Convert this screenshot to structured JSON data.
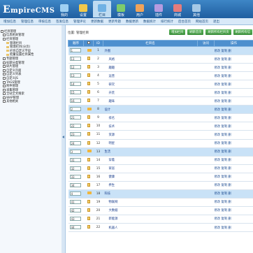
{
  "app": {
    "logo_big": "E",
    "logo_rest": "mpireCMS",
    "logo_dot": "."
  },
  "topnav": [
    {
      "label": "我的",
      "icon": "home-icon",
      "color": "#9fd0f2"
    },
    {
      "label": "设置",
      "icon": "gear-icon",
      "color": "#f2c94c"
    },
    {
      "label": "栏目",
      "icon": "folder-icon",
      "color": "#6fb1e4"
    },
    {
      "label": "模板",
      "icon": "template-icon",
      "color": "#7ecb6c"
    },
    {
      "label": "用户",
      "icon": "user-icon",
      "color": "#f0a35a"
    },
    {
      "label": "插件",
      "icon": "plugin-icon",
      "color": "#b59be0"
    },
    {
      "label": "商城",
      "icon": "cart-icon",
      "color": "#e57c7c"
    },
    {
      "label": "其他",
      "icon": "more-icon",
      "color": "#a5c8e6"
    }
  ],
  "active_tab": 2,
  "subnav": [
    "增加信息",
    "管理信息",
    "审核信息",
    "签发信息",
    "管理评论",
    "更新数据",
    "更新专题",
    "数据更新",
    "数据统计",
    "排行统计",
    "后台首页",
    "网站首页",
    "退出"
  ],
  "tree": [
    {
      "label": "栏目管理",
      "level": 0,
      "box": true
    },
    {
      "label": "信息相关管理",
      "level": 1,
      "box": true
    },
    {
      "label": "栏目管理",
      "level": 1,
      "box": true
    },
    {
      "label": "管理栏目",
      "level": 2
    },
    {
      "label": "管理栏目(分页)",
      "level": 2
    },
    {
      "label": "栏目自定义字段",
      "level": 2
    },
    {
      "label": "批量设置栏目属性",
      "level": 2
    },
    {
      "label": "专题管理",
      "level": 1,
      "box": true
    },
    {
      "label": "标题分类管理",
      "level": 1,
      "box": true
    },
    {
      "label": "碎片管理",
      "level": 1,
      "box": true
    },
    {
      "label": "自定义页面",
      "level": 1,
      "box": true
    },
    {
      "label": "自定义列表",
      "level": 1,
      "box": true
    },
    {
      "label": "自定义JS",
      "level": 1,
      "box": true
    },
    {
      "label": "TAGS管理",
      "level": 1,
      "box": true
    },
    {
      "label": "附件管理",
      "level": 1,
      "box": true
    },
    {
      "label": "采集管理",
      "level": 1,
      "box": true
    },
    {
      "label": "全站全文搜索",
      "level": 1,
      "box": true
    },
    {
      "label": "WAP管理",
      "level": 1,
      "box": true
    },
    {
      "label": "其他相关",
      "level": 1,
      "box": true
    }
  ],
  "crumb": "位置: 管理栏目",
  "buttons": [
    "增加栏目",
    "刷新首页",
    "刷新所有栏目页",
    "刷新所有信"
  ],
  "table": {
    "headers": [
      "顺序",
      "",
      "ID",
      "栏目名",
      "访问",
      "操作"
    ],
    "rows": [
      {
        "ord": "1",
        "type": "folder",
        "id": "1",
        "name": "外图",
        "ops": "修改 复制 删",
        "dark": true
      },
      {
        "ord": "11",
        "type": "doc",
        "id": "2",
        "name": "风格",
        "ops": "修改 复制 删",
        "dark": false
      },
      {
        "ord": "12",
        "type": "doc",
        "id": "3",
        "name": "趣趣",
        "ops": "修改 复制 删",
        "dark": false
      },
      {
        "ord": "13",
        "type": "doc",
        "id": "4",
        "name": "运营",
        "ops": "修改 复制 删",
        "dark": false
      },
      {
        "ord": "14",
        "type": "doc",
        "id": "5",
        "name": "研究",
        "ops": "修改 复制 删",
        "dark": false
      },
      {
        "ord": "15",
        "type": "doc",
        "id": "6",
        "name": "开荒",
        "ops": "修改 复制 删",
        "dark": false
      },
      {
        "ord": "16",
        "type": "doc",
        "id": "7",
        "name": "趣味",
        "ops": "修改 复制 删",
        "dark": false
      },
      {
        "ord": "2",
        "type": "folder",
        "id": "8",
        "name": "设计",
        "ops": "修改 复制 删",
        "dark": true
      },
      {
        "ord": "21",
        "type": "doc",
        "id": "9",
        "name": "排名",
        "ops": "修改 复制 删",
        "dark": false
      },
      {
        "ord": "22",
        "type": "doc",
        "id": "10",
        "name": "技术",
        "ops": "修改 复制 删",
        "dark": false
      },
      {
        "ord": "23",
        "type": "doc",
        "id": "11",
        "name": "资源",
        "ops": "修改 复制 删",
        "dark": false
      },
      {
        "ord": "24",
        "type": "doc",
        "id": "12",
        "name": "明星",
        "ops": "修改 复制 删",
        "dark": false
      },
      {
        "ord": "3",
        "type": "folder",
        "id": "13",
        "name": "生活",
        "ops": "修改 复制 删",
        "dark": true
      },
      {
        "ord": "31",
        "type": "doc",
        "id": "14",
        "name": "穿着",
        "ops": "修改 复制 删",
        "dark": false
      },
      {
        "ord": "32",
        "type": "doc",
        "id": "15",
        "name": "家居",
        "ops": "修改 复制 删",
        "dark": false
      },
      {
        "ord": "33",
        "type": "doc",
        "id": "16",
        "name": "健康",
        "ops": "修改 复制 删",
        "dark": false
      },
      {
        "ord": "34",
        "type": "doc",
        "id": "17",
        "name": "养生",
        "ops": "修改 复制 删",
        "dark": false
      },
      {
        "ord": "4",
        "type": "folder",
        "id": "18",
        "name": "科技",
        "ops": "修改 复制 删",
        "dark": true
      },
      {
        "ord": "41",
        "type": "doc",
        "id": "19",
        "name": "物联网",
        "ops": "修改 复制 删",
        "dark": false
      },
      {
        "ord": "42",
        "type": "doc",
        "id": "20",
        "name": "大数据",
        "ops": "修改 复制 删",
        "dark": false
      },
      {
        "ord": "43",
        "type": "doc",
        "id": "21",
        "name": "新能源",
        "ops": "修改 复制 删",
        "dark": false
      },
      {
        "ord": "44",
        "type": "doc",
        "id": "22",
        "name": "机器人",
        "ops": "修改 复制 删",
        "dark": false
      }
    ]
  }
}
